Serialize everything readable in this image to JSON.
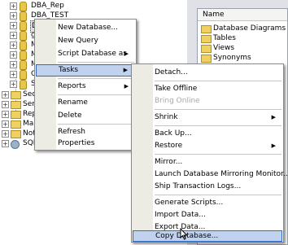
{
  "tree": {
    "nodes": [
      {
        "label": "DBA_Rep",
        "kind": "db",
        "expander": "+"
      },
      {
        "label": "DBA_TEST",
        "kind": "db",
        "expander": "+"
      },
      {
        "label": "DE",
        "kind": "db",
        "expander": "+",
        "selected": true
      },
      {
        "label": "ge",
        "kind": "db",
        "expander": "+"
      },
      {
        "label": "My",
        "kind": "db",
        "expander": "+"
      },
      {
        "label": "My",
        "kind": "db",
        "expander": "+"
      },
      {
        "label": "My",
        "kind": "db",
        "expander": "+"
      },
      {
        "label": "OF",
        "kind": "db",
        "expander": "+"
      },
      {
        "label": "SQ",
        "kind": "db",
        "expander": "+"
      },
      {
        "label": "Securi",
        "kind": "folder",
        "expander": "+"
      },
      {
        "label": "Server",
        "kind": "folder",
        "expander": "+"
      },
      {
        "label": "Replica",
        "kind": "folder",
        "expander": "+"
      },
      {
        "label": "Manag",
        "kind": "folder",
        "expander": "+"
      },
      {
        "label": "Notific",
        "kind": "folder",
        "expander": "+"
      },
      {
        "label": "SQL Se",
        "kind": "agent",
        "expander": "+"
      }
    ]
  },
  "details": {
    "column_header": "Name",
    "items": [
      "Database Diagrams",
      "Tables",
      "Views",
      "Synonyms"
    ]
  },
  "context_menu": {
    "items": [
      {
        "label": "New Database...",
        "type": "item"
      },
      {
        "label": "New Query",
        "type": "item"
      },
      {
        "label": "Script Database as",
        "type": "item",
        "submenu": true
      },
      {
        "label": "Tasks",
        "type": "item",
        "submenu": true,
        "highlighted": true
      },
      {
        "label": "Reports",
        "type": "item",
        "submenu": true
      },
      {
        "label": "Rename",
        "type": "item"
      },
      {
        "label": "Delete",
        "type": "item"
      },
      {
        "label": "Refresh",
        "type": "item"
      },
      {
        "label": "Properties",
        "type": "item"
      }
    ]
  },
  "tasks_submenu": {
    "items": [
      {
        "label": "Detach...",
        "type": "item"
      },
      {
        "label": "Take Offline",
        "type": "item"
      },
      {
        "label": "Bring Online",
        "type": "item",
        "disabled": true
      },
      {
        "label": "Shrink",
        "type": "item",
        "submenu": true
      },
      {
        "label": "Back Up...",
        "type": "item"
      },
      {
        "label": "Restore",
        "type": "item",
        "submenu": true
      },
      {
        "label": "Mirror...",
        "type": "item"
      },
      {
        "label": "Launch Database Mirroring Monitor...",
        "type": "item"
      },
      {
        "label": "Ship Transaction Logs...",
        "type": "item"
      },
      {
        "label": "Generate Scripts...",
        "type": "item"
      },
      {
        "label": "Import Data...",
        "type": "item"
      },
      {
        "label": "Export Data...",
        "type": "item"
      },
      {
        "label": "Copy Database...",
        "type": "item",
        "highlighted": true
      }
    ]
  },
  "icons": {
    "submenu_arrow": "▶",
    "expander": "+",
    "pointer": "mouse-pointer-icon"
  },
  "colors": {
    "highlight_bg": "#c1d2ee",
    "highlight_border": "#316ac5",
    "menu_gutter": "#ecebe4",
    "disabled_text": "#a8a8a8"
  }
}
